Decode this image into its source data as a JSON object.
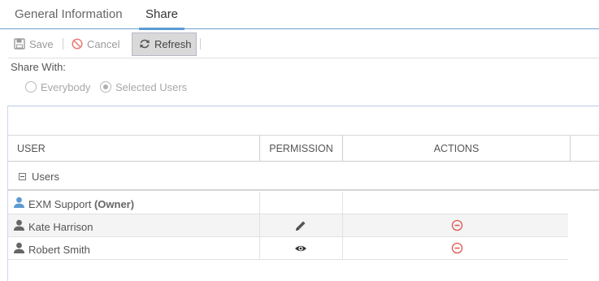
{
  "tabs": [
    {
      "label": "General Information",
      "active": false
    },
    {
      "label": "Share",
      "active": true
    }
  ],
  "toolbar": {
    "save_label": "Save",
    "cancel_label": "Cancel",
    "refresh_label": "Refresh"
  },
  "share_with": {
    "label": "Share With:",
    "options": [
      {
        "label": "Everybody",
        "selected": false
      },
      {
        "label": "Selected Users",
        "selected": true
      }
    ]
  },
  "grid": {
    "columns": [
      "USER",
      "PERMISSION",
      "ACTIONS"
    ],
    "group_label": "Users",
    "rows": [
      {
        "name": "EXM Support",
        "role": "(Owner)",
        "permission_icon": "",
        "action_icon": ""
      },
      {
        "name": "Kate Harrison",
        "role": "",
        "permission_icon": "pencil-icon",
        "action_icon": "remove-circle-icon"
      },
      {
        "name": "Robert Smith",
        "role": "",
        "permission_icon": "eye-icon",
        "action_icon": "remove-circle-icon"
      }
    ]
  },
  "colors": {
    "accent": "#5b9bd5",
    "owner_icon": "#5b9bd5",
    "remove": "#e0524a"
  }
}
